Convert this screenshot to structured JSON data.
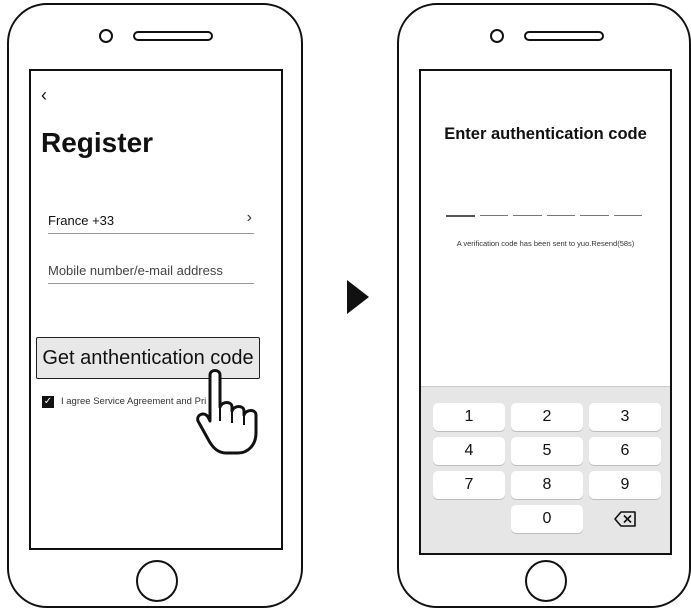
{
  "register_screen": {
    "back_icon": "chevron-left-icon",
    "title": "Register",
    "country": "France +33",
    "country_chevron": "chevron-right-icon",
    "mobile_placeholder": "Mobile number/e-mail address",
    "get_code_label": "Get anthentication code",
    "agree_text": "I agree Service Agreement and Pri",
    "agree_checked": true
  },
  "flow_arrow_icon": "play-arrow-icon",
  "auth_screen": {
    "title": "Enter authentication code",
    "code_slots": 6,
    "message": "A verification code has been sent to yuo.Resend(58s)",
    "keypad": {
      "keys": [
        "1",
        "2",
        "3",
        "4",
        "5",
        "6",
        "7",
        "8",
        "9",
        "0"
      ],
      "backspace_icon": "backspace-icon"
    }
  },
  "colors": {
    "outline": "#111111",
    "button_bg": "#e8e8e8",
    "keypad_bg": "#e6e6e6",
    "key_bg": "#ffffff"
  }
}
